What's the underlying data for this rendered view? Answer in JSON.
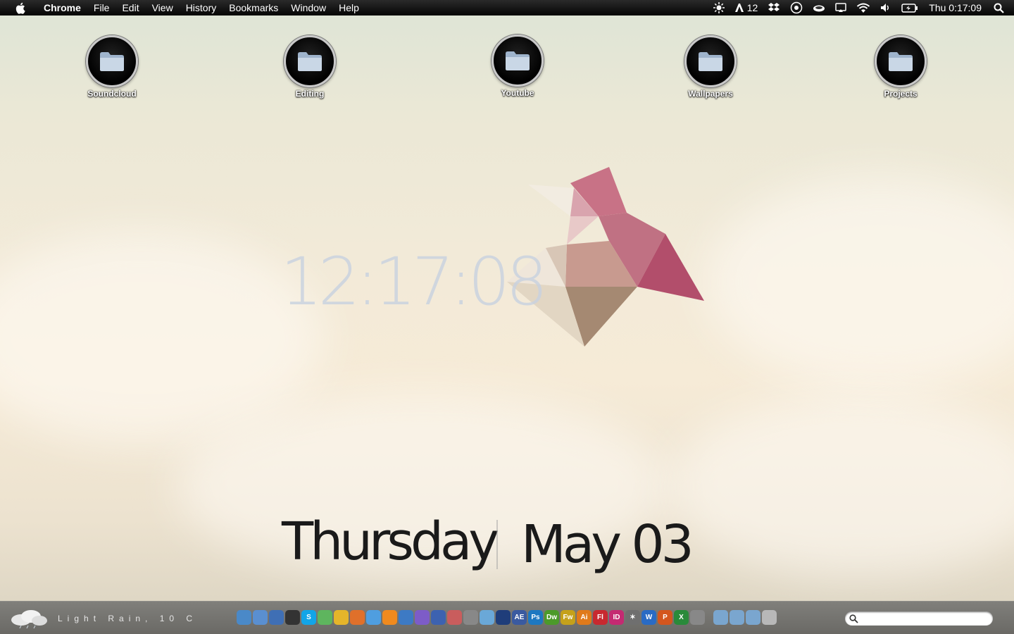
{
  "menubar": {
    "app_name": "Chrome",
    "items": [
      "File",
      "Edit",
      "View",
      "History",
      "Bookmarks",
      "Window",
      "Help"
    ],
    "status": {
      "adobe_count": "12",
      "clock": "Thu 0:17:09"
    }
  },
  "desktop_icons": [
    {
      "label": "Soundcloud"
    },
    {
      "label": "Editing"
    },
    {
      "label": "Youtube"
    },
    {
      "label": "Wallpapers"
    },
    {
      "label": "Projects"
    }
  ],
  "widgets": {
    "time": "12:17:08",
    "day": "Thursday",
    "date": "May 03"
  },
  "bottombar": {
    "weather": "Light Rain, 10 C",
    "dock_icons": [
      {
        "name": "finder-icon",
        "color": "#4a89c8",
        "text": ""
      },
      {
        "name": "mail-icon",
        "color": "#5a8fd0",
        "text": ""
      },
      {
        "name": "itunes-icon",
        "color": "#3f6fb5",
        "text": ""
      },
      {
        "name": "dashboard-icon",
        "color": "#333333",
        "text": ""
      },
      {
        "name": "skype-icon",
        "color": "#12a5e8",
        "text": "S"
      },
      {
        "name": "adium-icon",
        "color": "#5eb55e",
        "text": ""
      },
      {
        "name": "chrome-icon",
        "color": "#e5b52a",
        "text": ""
      },
      {
        "name": "firefox-icon",
        "color": "#e0702a",
        "text": ""
      },
      {
        "name": "safari-icon",
        "color": "#4f9ee0",
        "text": ""
      },
      {
        "name": "vlc-icon",
        "color": "#f08a1e",
        "text": ""
      },
      {
        "name": "music-icon",
        "color": "#3d7ac4",
        "text": ""
      },
      {
        "name": "spiral-icon",
        "color": "#7d5cc8",
        "text": ""
      },
      {
        "name": "app-icon",
        "color": "#3d62b0",
        "text": ""
      },
      {
        "name": "photos-icon",
        "color": "#c95d5d",
        "text": ""
      },
      {
        "name": "preview-icon",
        "color": "#888888",
        "text": ""
      },
      {
        "name": "brush-icon",
        "color": "#6aa8d8",
        "text": ""
      },
      {
        "name": "cinema4d-icon",
        "color": "#1f3d7a",
        "text": ""
      },
      {
        "name": "aftereffects-icon",
        "color": "#3a5aa0",
        "text": "AE"
      },
      {
        "name": "photoshop-icon",
        "color": "#1d78c1",
        "text": "Ps"
      },
      {
        "name": "dreamweaver-icon",
        "color": "#4c9a2a",
        "text": "Dw"
      },
      {
        "name": "fireworks-icon",
        "color": "#c5a11a",
        "text": "Fw"
      },
      {
        "name": "illustrator-icon",
        "color": "#e07a1a",
        "text": "Ai"
      },
      {
        "name": "flash-icon",
        "color": "#c8292f",
        "text": "Fl"
      },
      {
        "name": "indesign-icon",
        "color": "#c42a72",
        "text": "ID"
      },
      {
        "name": "star-icon",
        "color": "#6f6f6f",
        "text": "✶"
      },
      {
        "name": "word-icon",
        "color": "#2a6bc4",
        "text": "W"
      },
      {
        "name": "powerpoint-icon",
        "color": "#d4561e",
        "text": "P"
      },
      {
        "name": "excel-icon",
        "color": "#2a8a3a",
        "text": "X"
      },
      {
        "name": "utility-icon",
        "color": "#888888",
        "text": ""
      },
      {
        "name": "applications-folder-icon",
        "color": "#7aa6cf",
        "text": ""
      },
      {
        "name": "documents-folder-icon",
        "color": "#7aa6cf",
        "text": ""
      },
      {
        "name": "downloads-folder-icon",
        "color": "#7aa6cf",
        "text": ""
      },
      {
        "name": "trash-icon",
        "color": "#b8b8b8",
        "text": ""
      }
    ],
    "search_placeholder": ""
  }
}
